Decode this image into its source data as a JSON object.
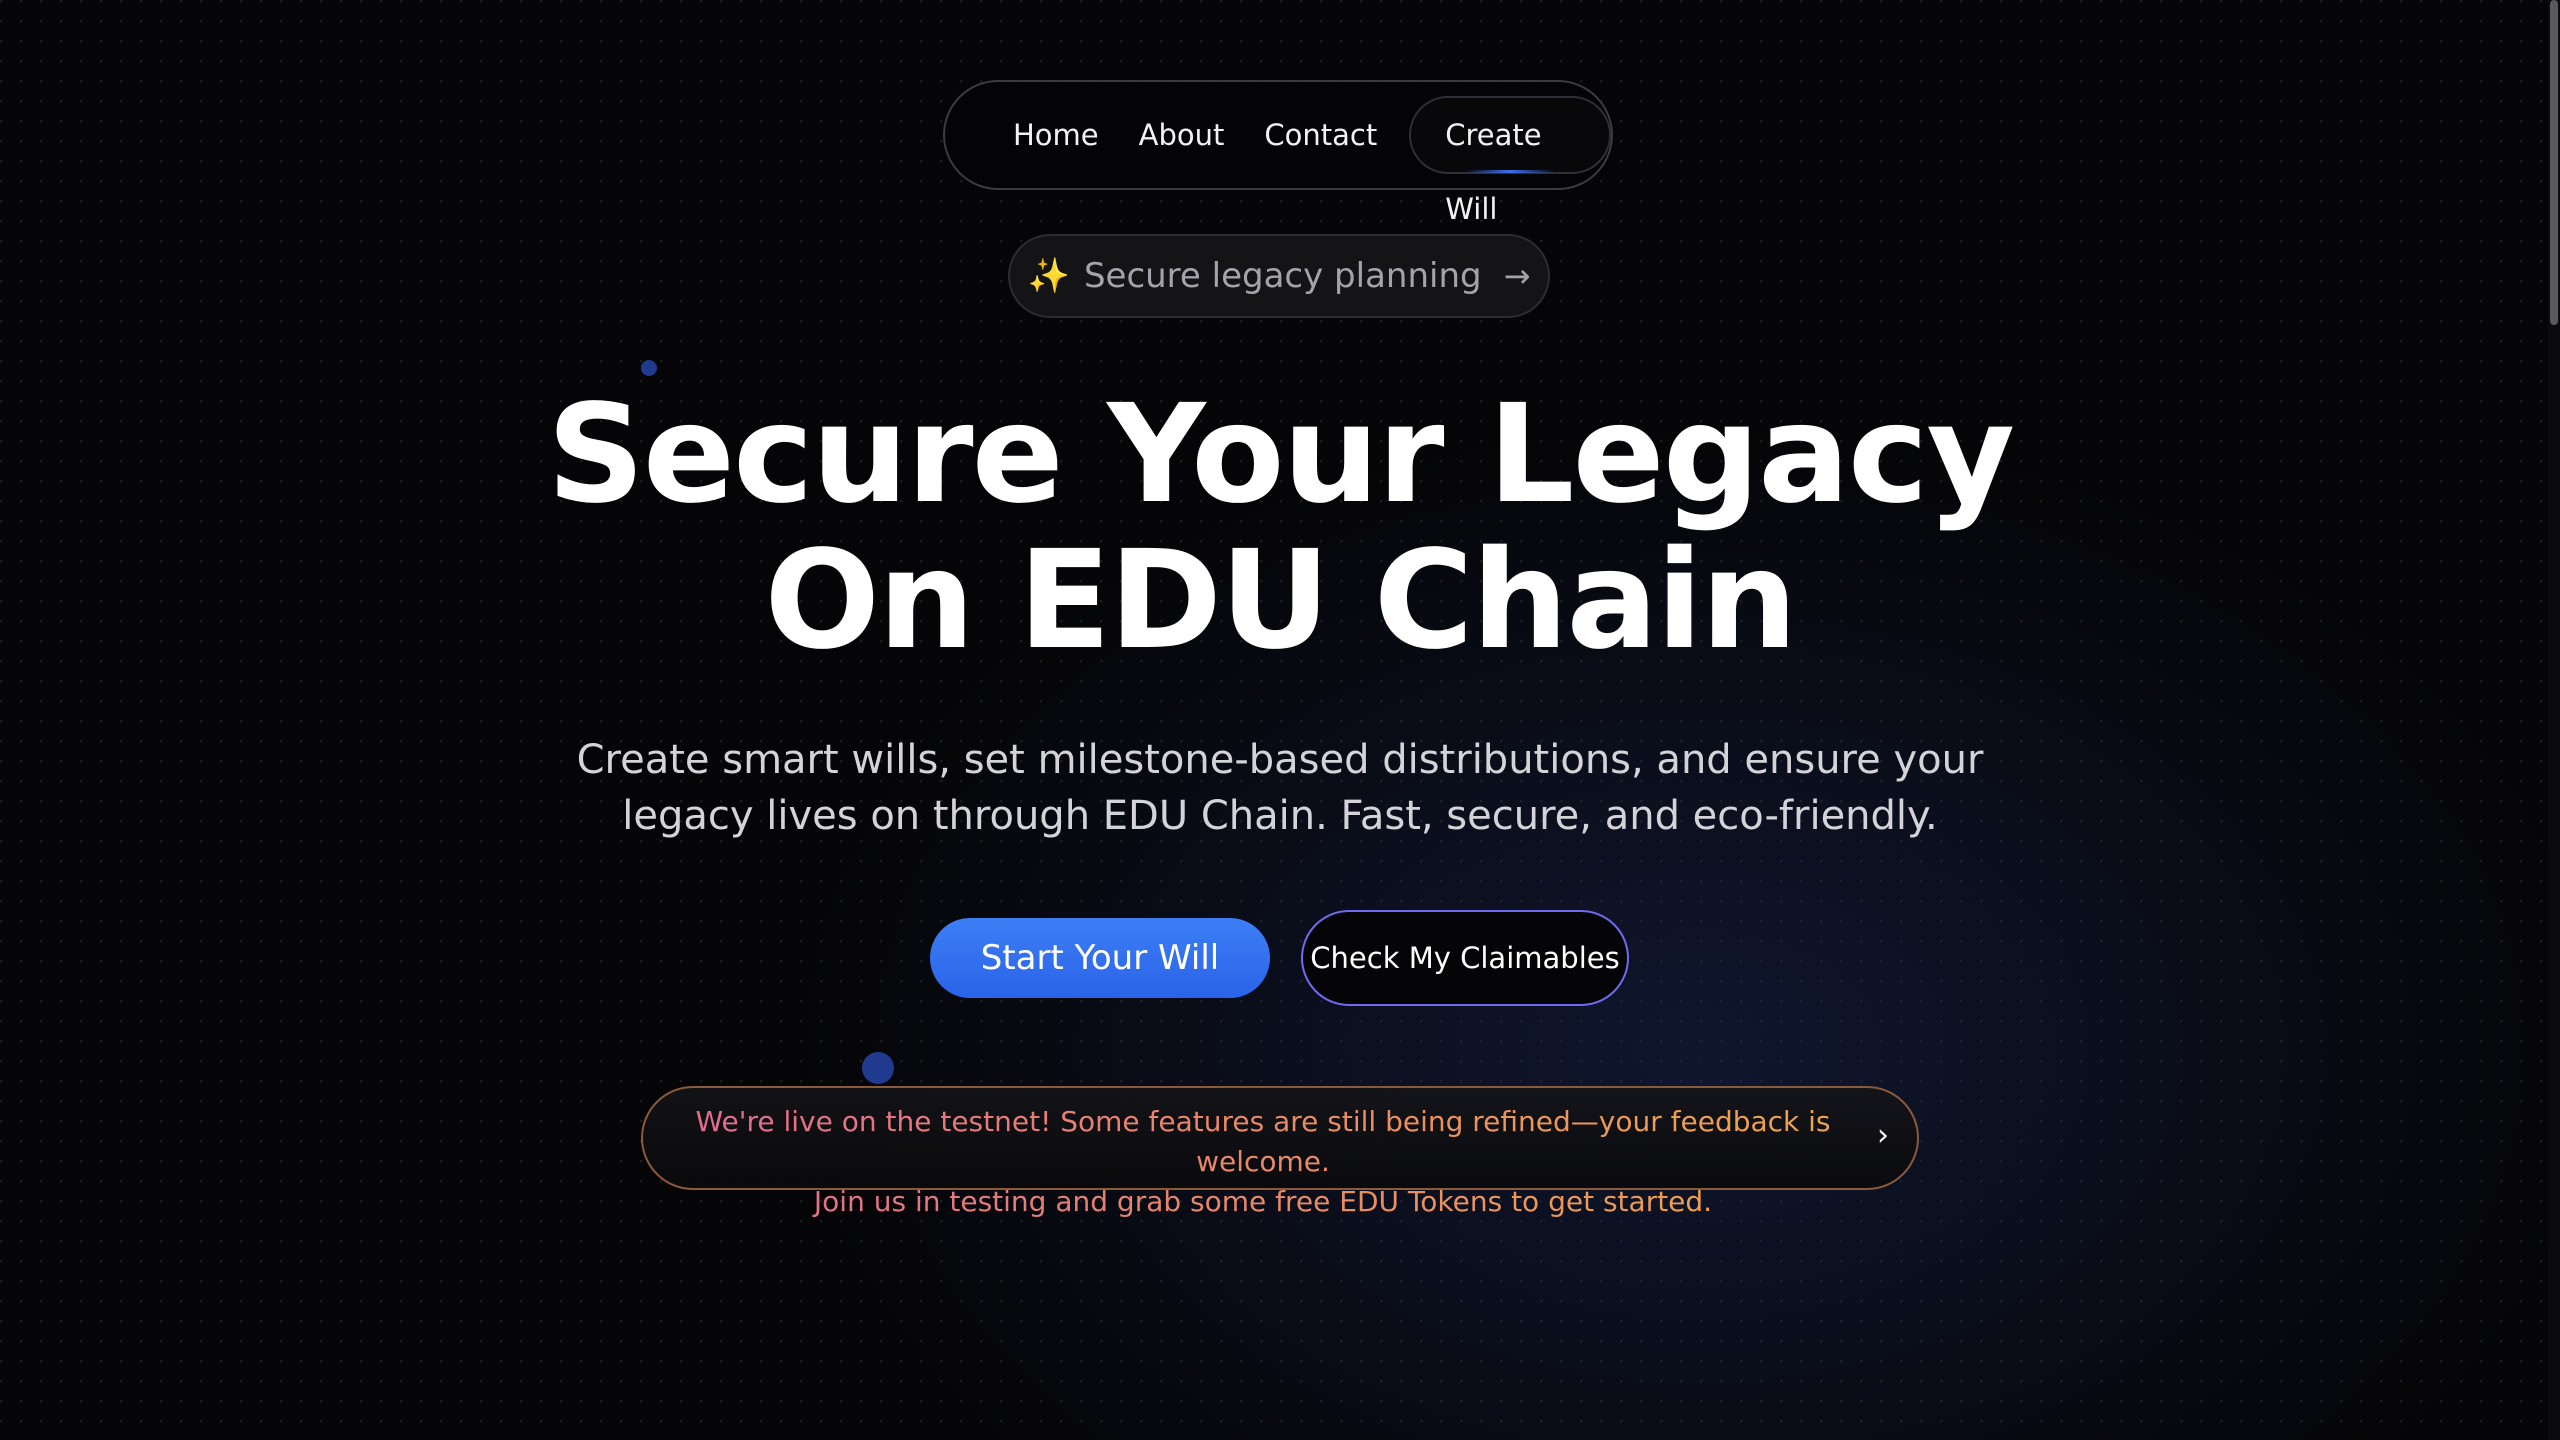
{
  "nav": {
    "items": [
      {
        "label": "Home"
      },
      {
        "label": "About"
      },
      {
        "label": "Contact"
      }
    ],
    "cta_label": "Create Will"
  },
  "badge": {
    "icon": "sparkles-icon",
    "label": "Secure legacy planning",
    "arrow": "→"
  },
  "hero": {
    "title_line1": "Secure Your Legacy",
    "title_line2": "On EDU Chain",
    "subtitle_line1": "Create smart wills, set milestone-based distributions, and ensure your",
    "subtitle_line2": "legacy lives on through EDU Chain. Fast, secure, and eco-friendly."
  },
  "actions": {
    "primary_label": "Start Your Will",
    "secondary_label": "Check My Claimables"
  },
  "announcement": {
    "line1": "We're live on the testnet! Some features are still being refined—your feedback is welcome.",
    "line2": "Join us in testing and grab some free EDU Tokens to get started.",
    "chevron": "›"
  },
  "colors": {
    "background": "#050507",
    "accent_blue": "#3b6ef0",
    "secondary_border": "#6f6af0",
    "announce_gradient_start": "#e06a93",
    "announce_gradient_end": "#f0a54a"
  }
}
